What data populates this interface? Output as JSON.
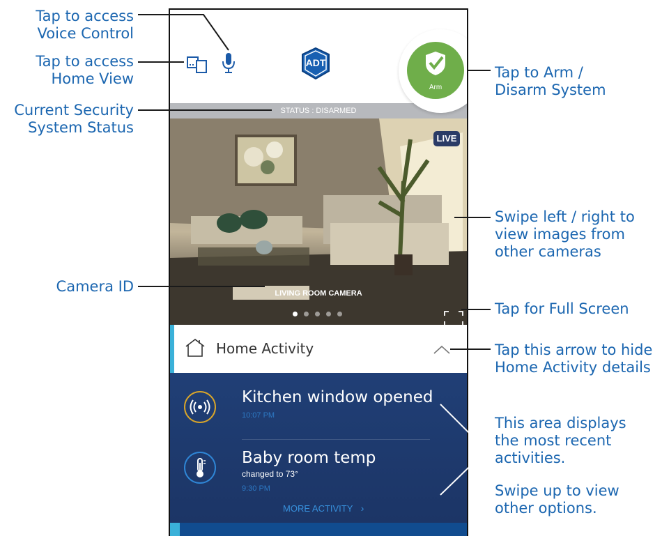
{
  "annotations": {
    "voice_control": [
      "Tap to access",
      "Voice Control"
    ],
    "home_view": [
      "Tap to access",
      "Home View"
    ],
    "current_status": [
      "Current Security",
      "System Status"
    ],
    "camera_id": "Camera ID",
    "arm_disarm": [
      "Tap to Arm /",
      "Disarm System"
    ],
    "swipe_cameras": [
      "Swipe left / right to",
      "view images from",
      "other cameras"
    ],
    "full_screen": "Tap for Full Screen",
    "hide_arrow": [
      "Tap this arrow to hide",
      "Home Activity details"
    ],
    "area_displays": [
      "This area displays",
      "the most recent",
      "activities."
    ],
    "swipe_up": [
      "Swipe up to view",
      "other options."
    ]
  },
  "app": {
    "logo_text": "ADT",
    "arm_label": "Arm",
    "status_text": "STATUS : DISARMED",
    "live_badge": "LIVE",
    "camera_name": "LIVING ROOM CAMERA",
    "carousel": {
      "count": 5,
      "active_index": 0
    },
    "home_activity_title": "Home Activity",
    "activities": [
      {
        "icon": "sensor-icon",
        "title": "Kitchen window opened",
        "subtitle": "",
        "time": "10:07 PM"
      },
      {
        "icon": "thermometer-icon",
        "title": "Baby room temp",
        "subtitle": "changed to 73°",
        "time": "9:30 PM"
      }
    ],
    "more_activity": "MORE ACTIVITY",
    "colors": {
      "annotation": "#1b66b0",
      "arm_green": "#6fae4a",
      "status_bar": "#b7b9bd",
      "activity_bg": "#203f76",
      "adt_blue": "#1860b2"
    }
  }
}
